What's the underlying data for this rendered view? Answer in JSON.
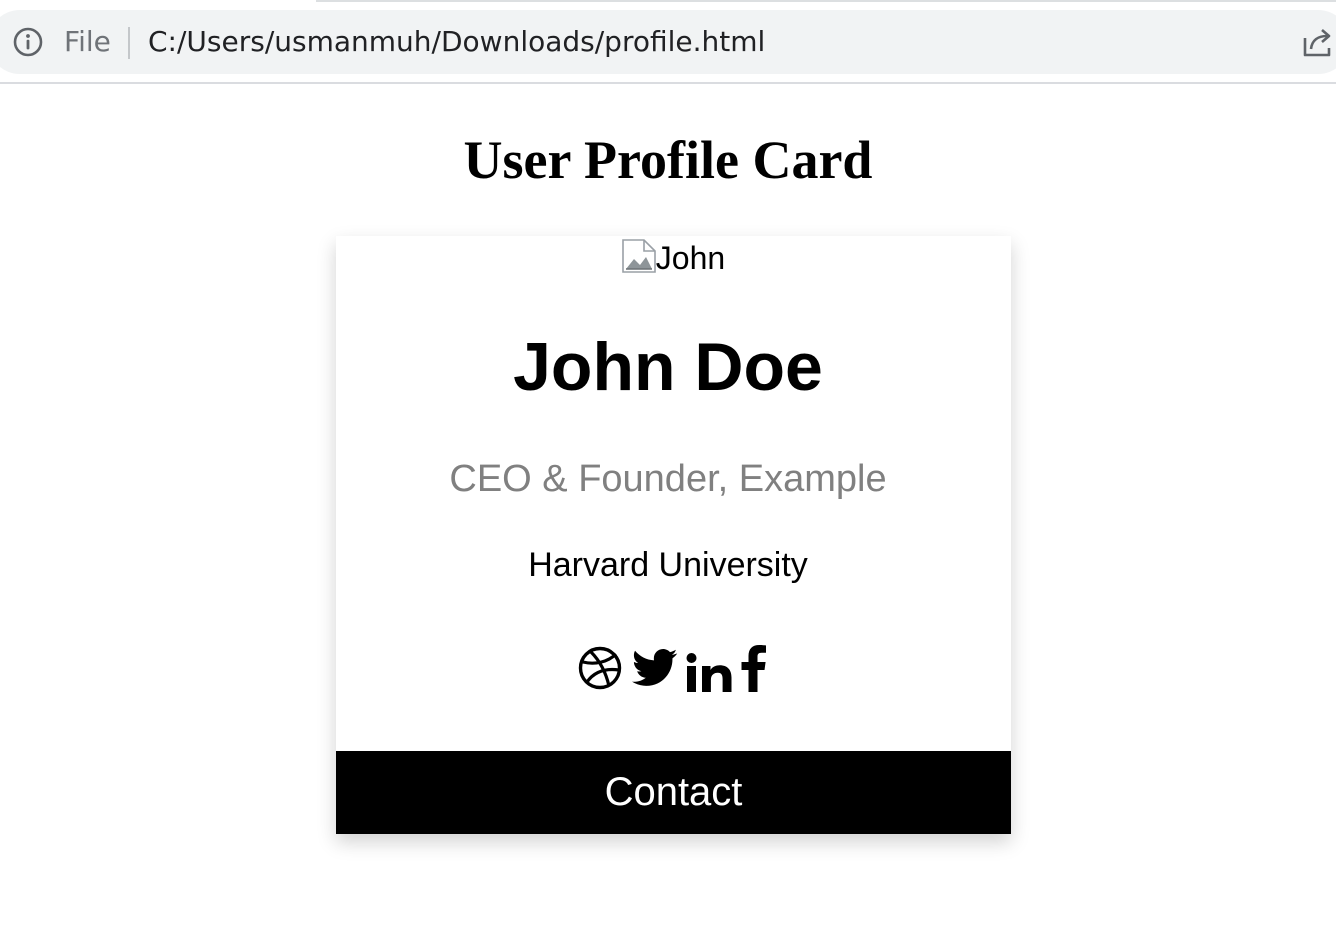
{
  "browser": {
    "scheme_label": "File",
    "url": "C:/Users/usmanmuh/Downloads/profile.html",
    "icons": [
      "info-icon",
      "share-icon"
    ]
  },
  "page": {
    "heading": "User Profile Card"
  },
  "card": {
    "avatar_alt": "John",
    "name": "John Doe",
    "title": "CEO & Founder, Example",
    "school": "Harvard University",
    "social_icons": [
      "dribbble-icon",
      "twitter-icon",
      "linkedin-icon",
      "facebook-icon"
    ],
    "contact_label": "Contact"
  },
  "colors": {
    "button_background": "#000000",
    "button_text": "#ffffff",
    "title_text": "#808080"
  }
}
